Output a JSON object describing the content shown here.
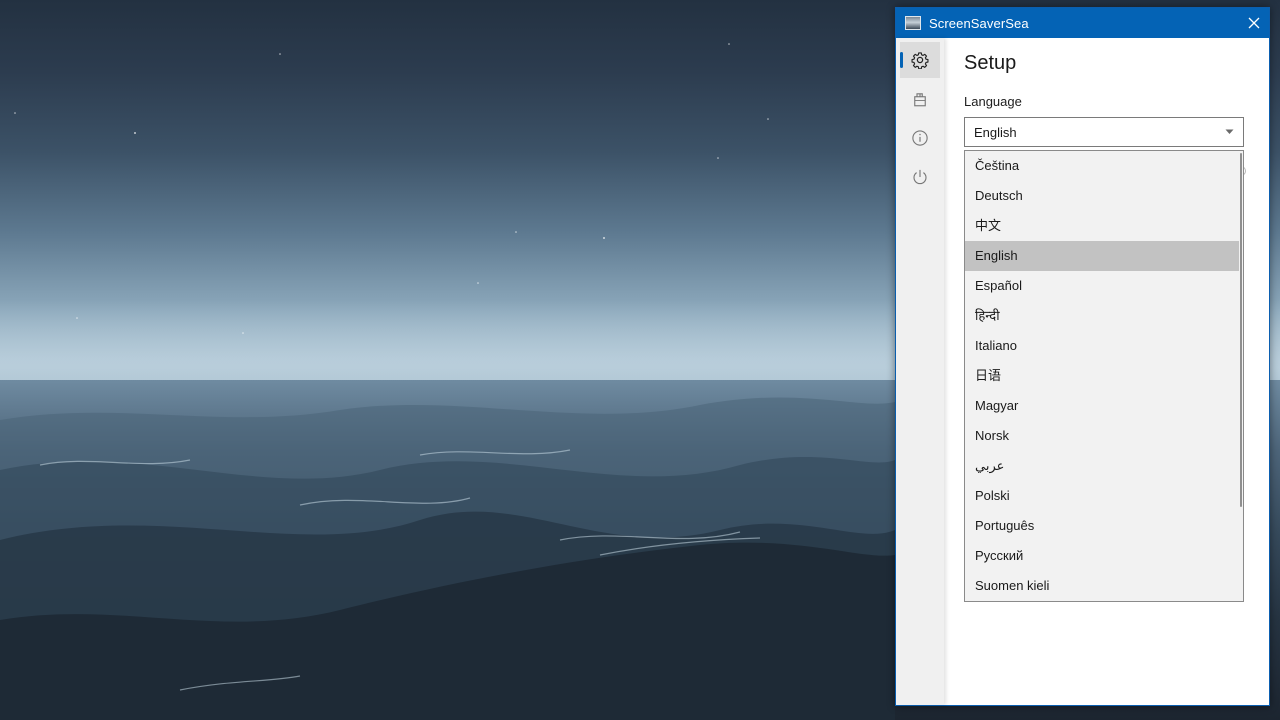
{
  "window": {
    "title": "ScreenSaverSea",
    "accent_color": "#0463b5"
  },
  "sidebar": {
    "items": [
      {
        "icon": "gear-icon",
        "name": "setup",
        "active": true
      },
      {
        "icon": "paint-bucket-icon",
        "name": "appearance",
        "active": false
      },
      {
        "icon": "info-icon",
        "name": "about",
        "active": false
      },
      {
        "icon": "power-icon",
        "name": "exit",
        "active": false
      }
    ]
  },
  "setup": {
    "title": "Setup",
    "language_label": "Language",
    "language_value": "English",
    "language_options": [
      "Čeština",
      "Deutsch",
      "中文",
      "English",
      "Español",
      "हिन्दी",
      "Italiano",
      "日语",
      "Magyar",
      "Norsk",
      "عربي",
      "Polski",
      "Português",
      "Русский",
      "Suomen kieli"
    ],
    "selected_index": 3
  }
}
